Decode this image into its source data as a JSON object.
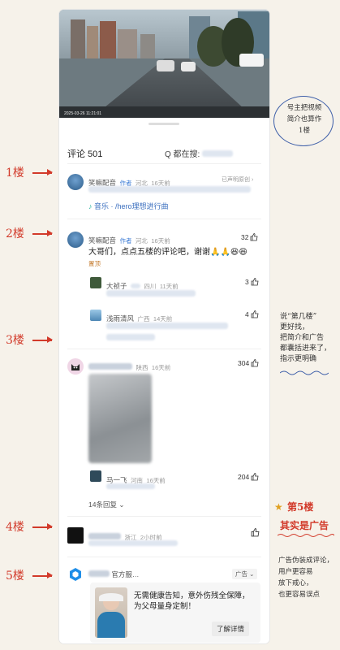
{
  "annotations": {
    "floor1": "1楼",
    "floor2": "2楼",
    "floor3": "3楼",
    "floor4": "4楼",
    "floor5": "5楼",
    "bubble": [
      "号主把视频",
      "简介也算作",
      "1楼"
    ],
    "side_note": [
      "说“第几楼”",
      "更好找，",
      "把简介和广告",
      "都囊括进来了，",
      "指示更明确"
    ],
    "floor5_title": "第5楼",
    "floor5_sub": "其实是广告",
    "ad_note": [
      "广告伪装成评论，",
      "用户更容易",
      "放下戒心，",
      "也更容易误点"
    ]
  },
  "video": {
    "timestamp": "2025-03-26  11:21:01"
  },
  "comments_header": {
    "title": "评论 501",
    "search_label": "Q 都在搜:"
  },
  "comment1": {
    "user": "笑嘛配音",
    "author_tag": "作者",
    "location": "河北",
    "time": "16天前",
    "right_text": "已声明原创 ›",
    "music_label": "音乐 · /hero理想进行曲"
  },
  "comment2": {
    "user": "笑嘛配音",
    "author_tag": "作者",
    "location": "河北",
    "time": "16天前",
    "text": "大哥们，点点五楼的评论吧，谢谢🙏🙏😆😆",
    "likes": "32",
    "pinned": "置顶",
    "reply1": {
      "user": "大祯子",
      "location": "四川",
      "time": "11天前",
      "likes": "3"
    },
    "reply2": {
      "user": "浅雨清风",
      "location": "广西",
      "time": "14天前",
      "likes": "4"
    }
  },
  "comment3": {
    "location": "陕西",
    "time": "16天前",
    "likes": "304",
    "reply": {
      "user": "马一飞",
      "location": "河南",
      "time": "16天前",
      "likes": "204"
    },
    "more": "14条回复 ⌄"
  },
  "comment4": {
    "location": "浙江",
    "time": "2小时前"
  },
  "ad": {
    "brand": "官方服…",
    "tag": "广告 ⌄",
    "text": "无需健康告知，意外伤残全保障，为父母量身定制！",
    "cta": "了解详情"
  }
}
